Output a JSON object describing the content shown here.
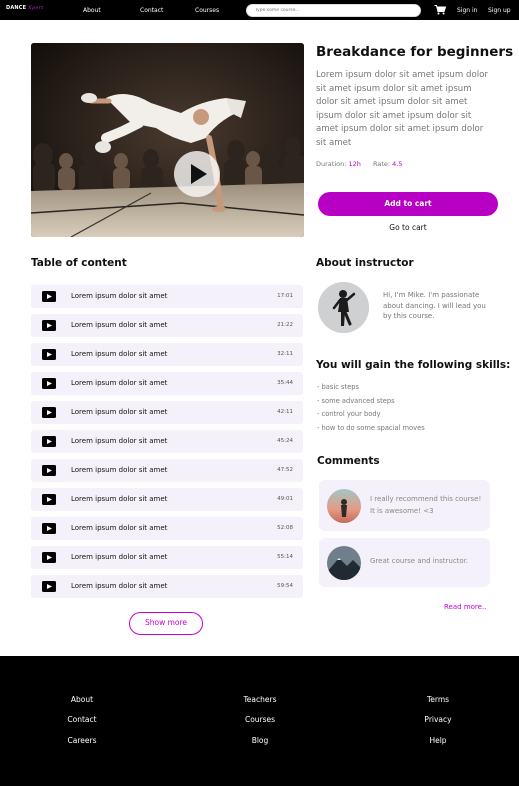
{
  "nav": {
    "logo_main": "DANCE",
    "logo_script": "Xpert",
    "links": [
      "About",
      "Contact",
      "Courses"
    ],
    "search_placeholder": "Type some course...",
    "sign_in": "Sign in",
    "sign_up": "Sign up"
  },
  "course": {
    "title": "Breakdance for beginners",
    "description": "Lorem ipsum dolor sit amet ipsum dolor sit amet  ipsum dolor sit amet ipsum dolor sit amet ipsum dolor sit amet ipsum dolor sit amet ipsum dolor sit amet ipsum dolor sit amet ipsum dolor sit amet",
    "duration_label": "Duration:",
    "duration_value": "12h",
    "rate_label": "Rate:",
    "rate_value": "4.5",
    "add_to_cart": "Add to cart",
    "go_to_cart": "Go to cart"
  },
  "toc": {
    "title": "Table of content",
    "items": [
      {
        "label": "Lorem ipsum dolor sit amet",
        "duration": "17:01"
      },
      {
        "label": "Lorem ipsum dolor sit amet",
        "duration": "21:22"
      },
      {
        "label": "Lorem ipsum dolor sit amet",
        "duration": "32:11"
      },
      {
        "label": "Lorem ipsum dolor sit amet",
        "duration": "35:44"
      },
      {
        "label": "Lorem ipsum dolor sit amet",
        "duration": "42:11"
      },
      {
        "label": "Lorem ipsum dolor sit amet",
        "duration": "45:24"
      },
      {
        "label": "Lorem ipsum dolor sit amet",
        "duration": "47:52"
      },
      {
        "label": "Lorem ipsum dolor sit amet",
        "duration": "49:01"
      },
      {
        "label": "Lorem ipsum dolor sit amet",
        "duration": "52:08"
      },
      {
        "label": "Lorem ipsum dolor sit amet",
        "duration": "55:14"
      },
      {
        "label": "Lorem ipsum dolor sit amet",
        "duration": "59:54"
      }
    ],
    "show_more": "Show more"
  },
  "instructor": {
    "title": "About instructor",
    "bio": "Hi, I'm Mike. I'm passionate about dancing. I will lead you by this course."
  },
  "skills": {
    "title": "You will gain the following skills:",
    "items": [
      "- basic steps",
      "- some advanced steps",
      "- control your body",
      "- how to do some spacial moves"
    ]
  },
  "comments": {
    "title": "Comments",
    "items": [
      {
        "text": "I really recommend this course! It is awesome! <3"
      },
      {
        "text": "Great course and instructor."
      }
    ],
    "read_more": "Read more.."
  },
  "footer": {
    "col1": [
      "About",
      "Contact",
      "Careers"
    ],
    "col2": [
      "Teachers",
      "Courses",
      "Blog"
    ],
    "col3": [
      "Terms",
      "Privacy",
      "Help"
    ]
  },
  "colors": {
    "accent": "#b800c4",
    "accent_text": "#c800d0",
    "nav_bg": "#000000",
    "row_bg": "#f5f1fa"
  },
  "icons": {
    "cart": "shopping-cart-icon",
    "play": "play-icon",
    "video": "video-play-icon"
  }
}
